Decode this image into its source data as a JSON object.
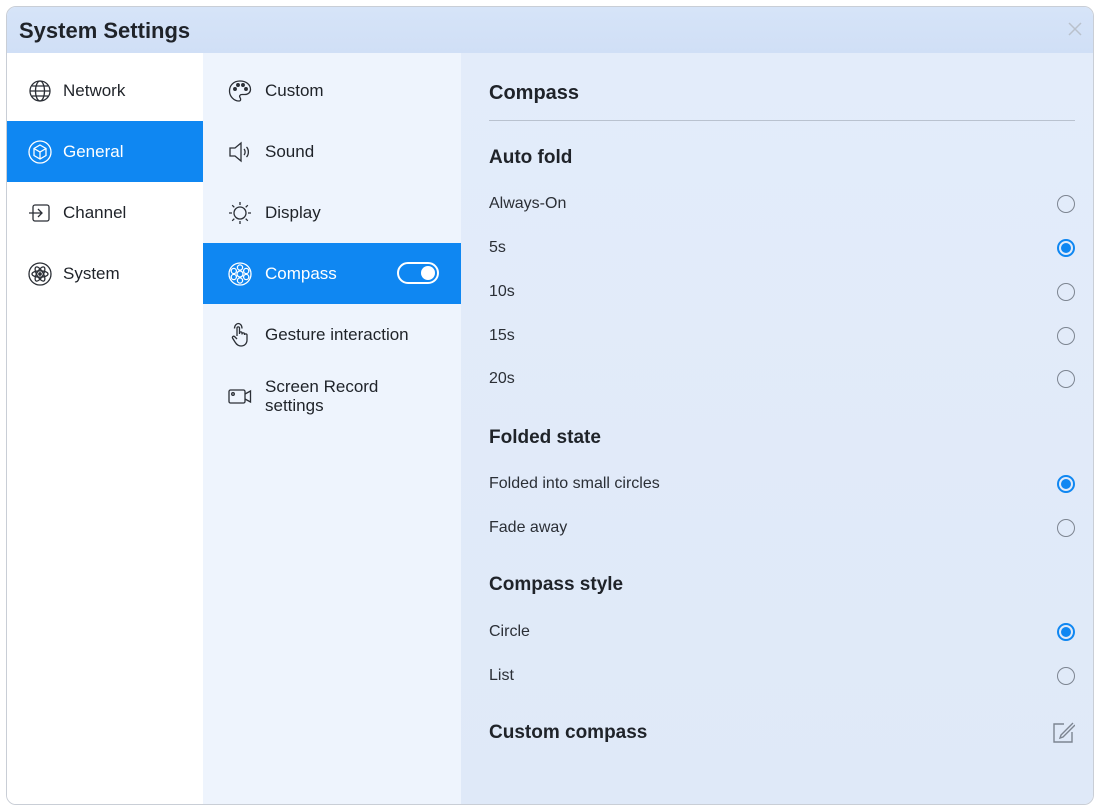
{
  "window": {
    "title": "System Settings"
  },
  "sidebar": {
    "items": [
      {
        "label": "Network",
        "icon": "globe-icon",
        "active": false
      },
      {
        "label": "General",
        "icon": "cube-icon",
        "active": true
      },
      {
        "label": "Channel",
        "icon": "input-icon",
        "active": false
      },
      {
        "label": "System",
        "icon": "atom-icon",
        "active": false
      }
    ]
  },
  "submenu": {
    "items": [
      {
        "label": "Custom",
        "icon": "palette-icon"
      },
      {
        "label": "Sound",
        "icon": "speaker-icon"
      },
      {
        "label": "Display",
        "icon": "brightness-icon"
      },
      {
        "label": "Compass",
        "icon": "compass-icon",
        "active": true,
        "toggle_on": true
      },
      {
        "label": "Gesture interaction",
        "icon": "hand-icon"
      },
      {
        "label_line1": "Screen Record",
        "label_line2": "settings",
        "icon": "camera-icon"
      }
    ]
  },
  "content": {
    "title": "Compass",
    "auto_fold": {
      "title": "Auto fold",
      "options": [
        {
          "label": "Always-On",
          "selected": false
        },
        {
          "label": "5s",
          "selected": true
        },
        {
          "label": "10s",
          "selected": false
        },
        {
          "label": "15s",
          "selected": false
        },
        {
          "label": "20s",
          "selected": false
        }
      ]
    },
    "folded_state": {
      "title": "Folded state",
      "options": [
        {
          "label": "Folded into small circles",
          "selected": true
        },
        {
          "label": "Fade away",
          "selected": false
        }
      ]
    },
    "compass_style": {
      "title": "Compass style",
      "options": [
        {
          "label": "Circle",
          "selected": true
        },
        {
          "label": "List",
          "selected": false
        }
      ]
    },
    "custom_compass": {
      "title": "Custom compass",
      "icon": "edit-icon"
    }
  },
  "colors": {
    "accent": "#0f87f2",
    "title_bar": "#d6e4f8",
    "submenu_bg": "#eef4fd"
  }
}
